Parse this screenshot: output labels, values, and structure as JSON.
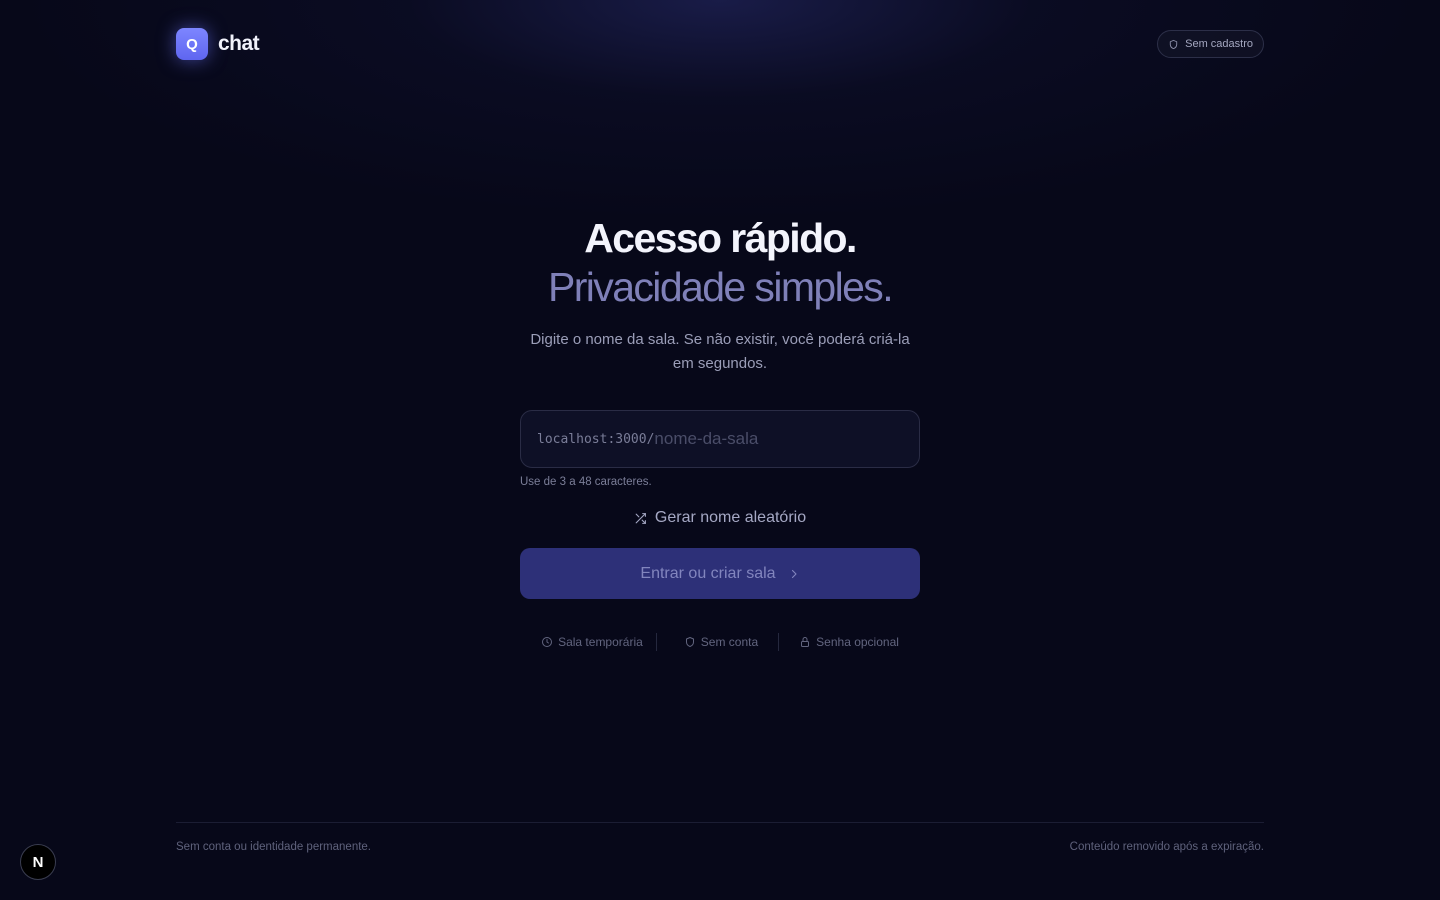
{
  "header": {
    "logo_letter": "Q",
    "brand": "chat",
    "badge": "Sem cadastro",
    "badge_icon": "shield-icon"
  },
  "hero": {
    "headline_1": "Acesso rápido.",
    "headline_2": "Privacidade simples.",
    "subtitle": "Digite o nome da sala. Se não existir, você poderá criá-la em segundos."
  },
  "form": {
    "prefix": "localhost:3000/",
    "input_value": "",
    "input_placeholder": "nome-da-sala",
    "hint": "Use de 3 a 48 caracteres.",
    "random_label": "Gerar nome aleatório",
    "random_icon": "shuffle-icon",
    "submit_label": "Entrar ou criar sala",
    "submit_icon": "chevron-right-icon"
  },
  "features": [
    {
      "label": "Sala temporária",
      "icon": "clock-icon"
    },
    {
      "label": "Sem conta",
      "icon": "shield-icon"
    },
    {
      "label": "Senha opcional",
      "icon": "lock-icon"
    }
  ],
  "footer": {
    "left": "Sem conta ou identidade permanente.",
    "right": "Conteúdo removido após a expiração."
  },
  "dev_indicator": "N",
  "colors": {
    "background": "#070819",
    "accent": "#6e76ff",
    "button": "#2d3078"
  }
}
